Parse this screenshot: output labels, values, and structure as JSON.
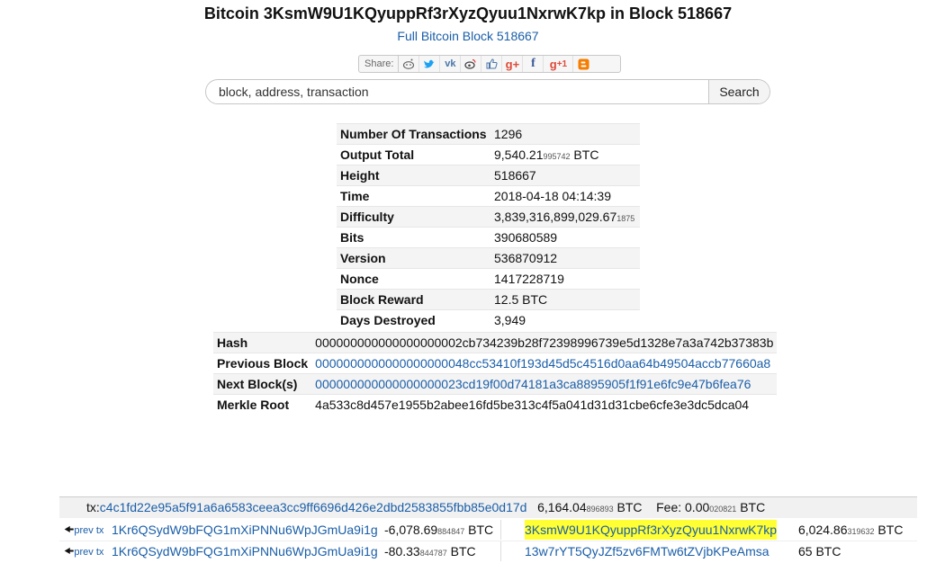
{
  "header": {
    "title": "Bitcoin 3KsmW9U1KQyuppRf3rXyzQyuu1NxrwK7kp in Block 518667",
    "subtitle_link": "Full Bitcoin Block 518667"
  },
  "share": {
    "label": "Share:",
    "icons": [
      "reddit-icon",
      "twitter-icon",
      "vk-icon",
      "weibo-icon",
      "like-icon",
      "google-plus-icon",
      "facebook-icon",
      "google-plus-one-icon",
      "blogger-icon"
    ],
    "colors": {
      "reddit": "#666666",
      "twitter": "#1da1f2",
      "vk": "#4a76a8",
      "weibo": "#444444",
      "like": "#4a76a8",
      "gplus": "#dd4b39",
      "facebook": "#3b5998",
      "blogger": "#f57d00"
    }
  },
  "search": {
    "placeholder": "block, address, transaction",
    "button": "Search"
  },
  "block_info": {
    "rows": [
      {
        "label": "Number Of Transactions",
        "value": "1296",
        "small": ""
      },
      {
        "label": "Output Total",
        "value": "9,540.21",
        "small": "995742",
        "suffix": " BTC"
      },
      {
        "label": "Height",
        "value": "518667",
        "small": ""
      },
      {
        "label": "Time",
        "value": "2018-04-18 04:14:39",
        "small": ""
      },
      {
        "label": "Difficulty",
        "value": "3,839,316,899,029.67",
        "small": "1875"
      },
      {
        "label": "Bits",
        "value": "390680589",
        "small": ""
      },
      {
        "label": "Version",
        "value": "536870912",
        "small": ""
      },
      {
        "label": "Nonce",
        "value": "1417228719",
        "small": ""
      },
      {
        "label": "Block Reward",
        "value": "12.5 BTC",
        "small": ""
      },
      {
        "label": "Days Destroyed",
        "value": "3,949",
        "small": ""
      }
    ]
  },
  "hashes": {
    "hash_label": "Hash",
    "hash_value": "000000000000000000002cb734239b28f72398996739e5d1328e7a3a742b37383b",
    "prev_label": "Previous Block",
    "prev_value": "0000000000000000000048cc53410f193d45d5c4516d0aa64b49504accb77660a8",
    "next_label": "Next Block(s)",
    "next_value": "000000000000000000023cd19f00d74181a3ca8895905f1f91e6fc9e47b6fea76",
    "merkle_label": "Merkle Root",
    "merkle_value": "4a533c8d457e1955b2abee16fd5be313c4f5a041d31d31cbe6cfe3e3dc5dca04"
  },
  "transaction": {
    "tx_prefix": "tx:",
    "tx_id": "c4c1fd22e95a5f91a6a6583ceea3cc9ff6696d426e2dbd2583855fbb85e0d17d",
    "total_main": "6,164.04",
    "total_small": "896893",
    "total_unit": " BTC",
    "fee_label": "Fee: 0.00",
    "fee_small": "020821",
    "fee_unit": " BTC",
    "rows": [
      {
        "prev": "prev tx",
        "in_addr": "1Kr6QSydW9bFQG1mXiPNNu6WpJGmUa9i1g",
        "in_main": "-6,078.69",
        "in_small": "884847",
        "in_unit": " BTC",
        "out_addr": "3KsmW9U1KQyuppRf3rXyzQyuu1NxrwK7kp",
        "out_main": "6,024.86",
        "out_small": "319632",
        "out_unit": " BTC"
      },
      {
        "prev": "prev tx",
        "in_addr": "1Kr6QSydW9bFQG1mXiPNNu6WpJGmUa9i1g",
        "in_main": "-80.33",
        "in_small": "844787",
        "in_unit": " BTC",
        "out_addr": "13w7rYT5QyJZf5zv6FMTw6tZVjbKPeAmsa",
        "out_main": "65 BTC",
        "out_small": "",
        "out_unit": ""
      }
    ]
  }
}
